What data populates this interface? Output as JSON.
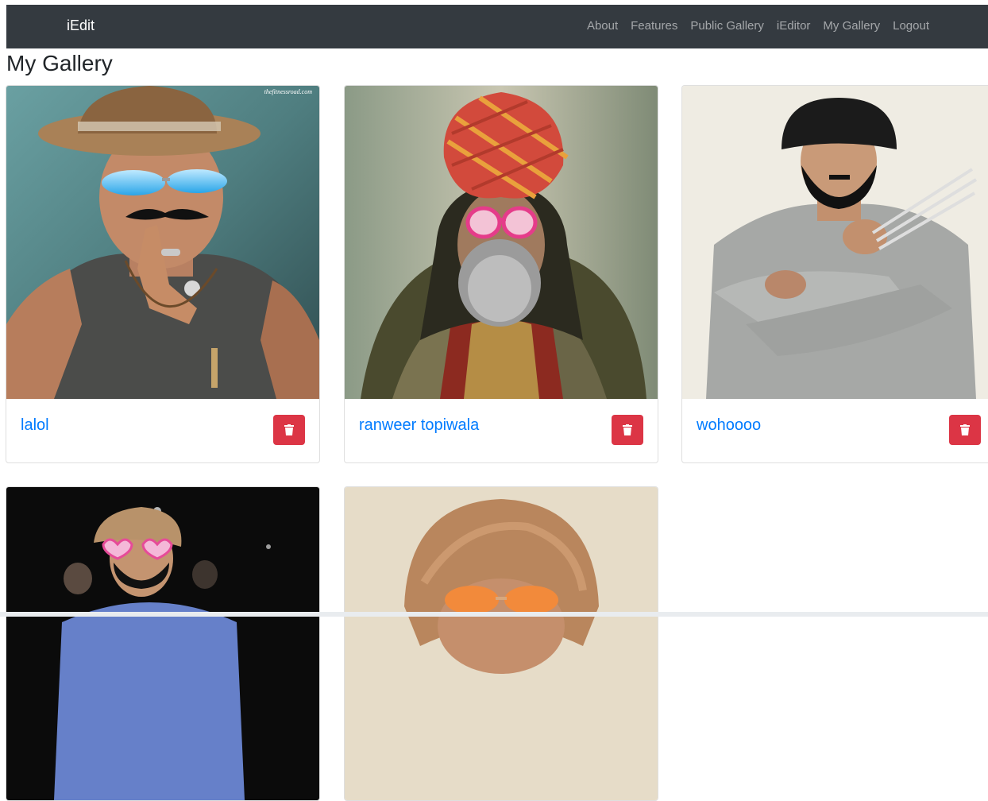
{
  "navbar": {
    "brand": "iEdit",
    "links": [
      "About",
      "Features",
      "Public Gallery",
      "iEditor",
      "My Gallery",
      "Logout"
    ]
  },
  "page": {
    "title": "My Gallery"
  },
  "gallery": {
    "items": [
      {
        "title": "lalol",
        "image_desc": "man with straw hat, blue sunglasses and mustache",
        "watermark": "thefitnessroad.com"
      },
      {
        "title": "ranweer topiwala",
        "image_desc": "man with red turban, pink heart glasses and grey beard"
      },
      {
        "title": "wohoooo",
        "image_desc": "man in grey sweater with black beanie and claws"
      },
      {
        "title": "",
        "image_desc": "man with wig and heart glasses on dark background"
      },
      {
        "title": "",
        "image_desc": "face with brown bowl wig and orange sunglasses"
      }
    ]
  },
  "colors": {
    "navbar_bg": "#343a40",
    "link": "#007bff",
    "danger": "#dc3545"
  },
  "icons": {
    "delete": "trash-icon"
  }
}
